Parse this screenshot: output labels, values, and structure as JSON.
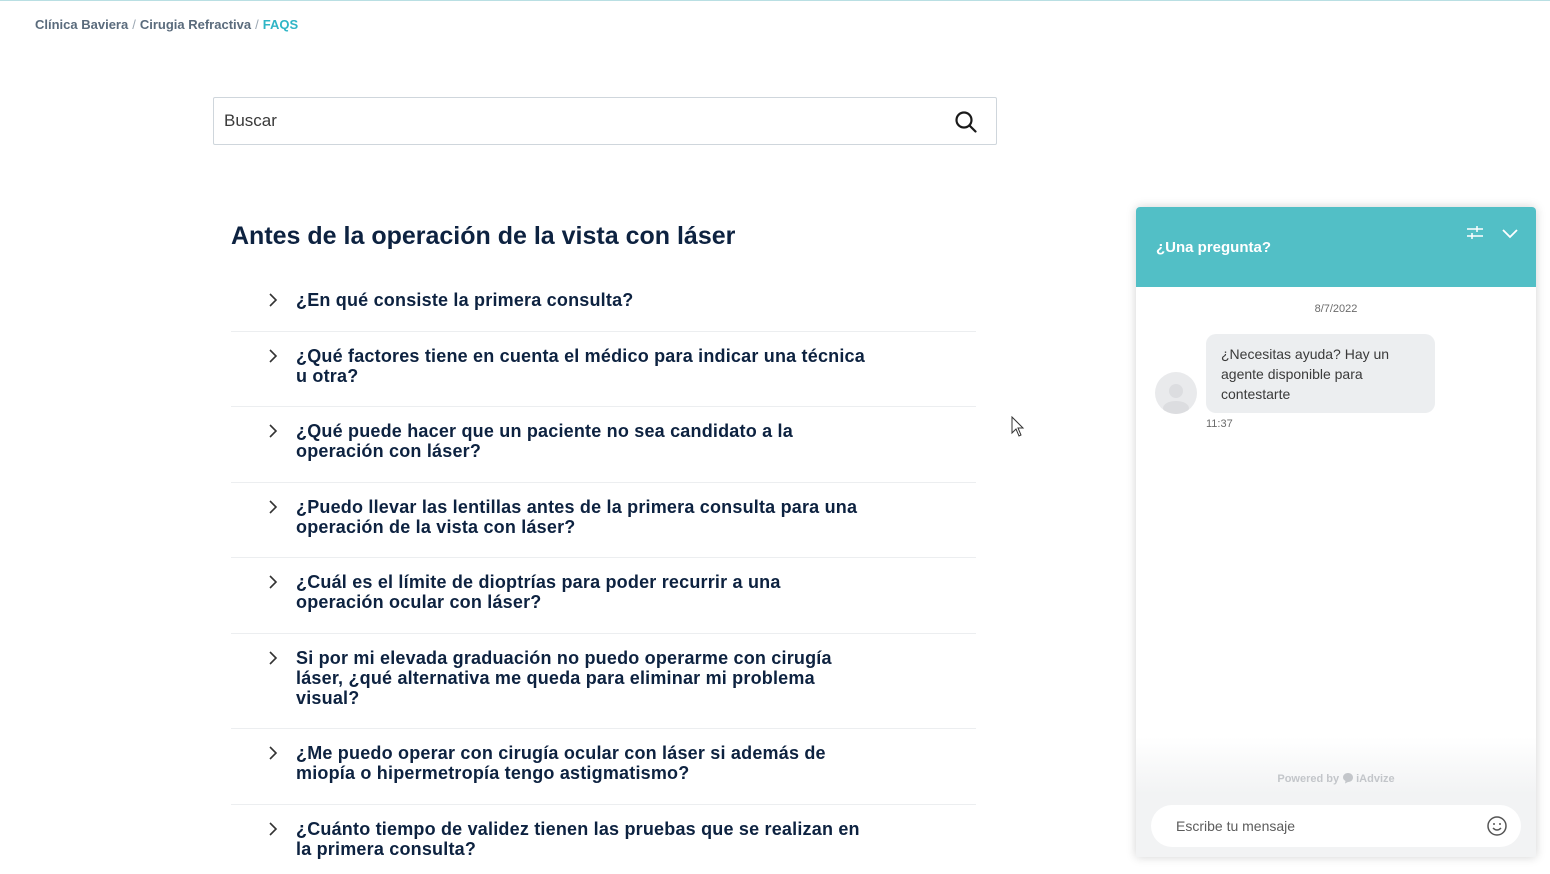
{
  "breadcrumb": {
    "items": [
      "Clínica Baviera",
      "Cirugia Refractiva"
    ],
    "separator": "/",
    "current": "FAQS"
  },
  "search": {
    "placeholder": "Buscar",
    "icon": "search-icon"
  },
  "section": {
    "title": "Antes de la operación de la vista con láser"
  },
  "faqs": [
    {
      "question": "¿En qué consiste la primera consulta?"
    },
    {
      "question": "¿Qué factores tiene en cuenta el médico para indicar una técnica u otra?"
    },
    {
      "question": "¿Qué puede hacer que un paciente no sea candidato a la operación con láser?"
    },
    {
      "question": "¿Puedo llevar las lentillas antes de la primera consulta para una operación de la vista con láser?"
    },
    {
      "question": "¿Cuál es el límite de dioptrías para poder recurrir a una operación ocular con láser?"
    },
    {
      "question": "Si por mi elevada graduación no puedo operarme con cirugía láser, ¿qué alternativa me queda para eliminar mi problema visual?"
    },
    {
      "question": "¿Me puedo operar con cirugía ocular con láser si además de miopía o hipermetropía tengo astigmatismo?"
    },
    {
      "question": "¿Cuánto tiempo de validez tienen las pruebas que se realizan en la primera consulta?"
    }
  ],
  "chat": {
    "title": "¿Una pregunta?",
    "date": "8/7/2022",
    "message": "¿Necesitas ayuda? Hay un agente disponible para contestarte",
    "time": "11:37",
    "powered_by": "Powered by",
    "brand": "iAdvize",
    "input_placeholder": "Escribe tu mensaje"
  },
  "colors": {
    "accent": "#2fb5c6",
    "chat_header": "#52bfc6",
    "heading": "#0d2240"
  }
}
